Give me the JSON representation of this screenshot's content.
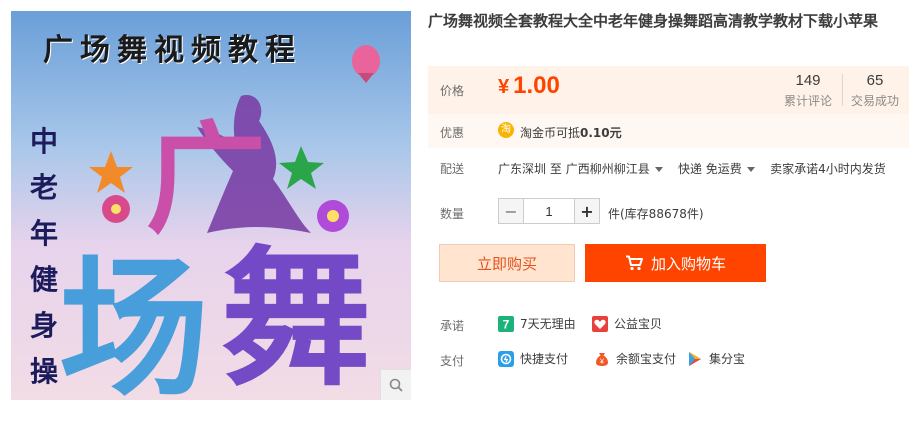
{
  "product": {
    "title": "广场舞视频全套教程大全中老年健身操舞蹈高清教学教材下载小苹果",
    "image": {
      "heading": "广场舞视频教程",
      "vertical": [
        "中",
        "老",
        "年",
        "健",
        "身",
        "操"
      ],
      "big_chars": [
        "广",
        "场",
        "舞"
      ]
    }
  },
  "price": {
    "label": "价格",
    "currency": "¥",
    "amount": "1.00",
    "reviews_count": "149",
    "reviews_label": "累计评论",
    "sales_count": "65",
    "sales_label": "交易成功"
  },
  "promo": {
    "label": "优惠",
    "coin_glyph": "淘",
    "text_prefix": "淘金币可抵",
    "text_amount": "0.10元"
  },
  "delivery": {
    "label": "配送",
    "from": "广东深圳",
    "to_word": "至",
    "to": "广西柳州柳江县",
    "shipping": "快递 免运费",
    "promise": "卖家承诺4小时内发货"
  },
  "quantity": {
    "label": "数量",
    "minus": "−",
    "value": "1",
    "plus": "+",
    "stock_text": "件(库存88678件)"
  },
  "actions": {
    "buy_now": "立即购买",
    "add_to_cart": "加入购物车"
  },
  "pledges": {
    "label": "承诺",
    "items": [
      "7天无理由",
      "公益宝贝"
    ]
  },
  "payment": {
    "label": "支付",
    "items": [
      "快捷支付",
      "余额宝支付",
      "集分宝"
    ]
  },
  "colors": {
    "accent": "#ff4400",
    "price_bg": "#fff2e8",
    "buy_bg": "#ffe4d0"
  }
}
